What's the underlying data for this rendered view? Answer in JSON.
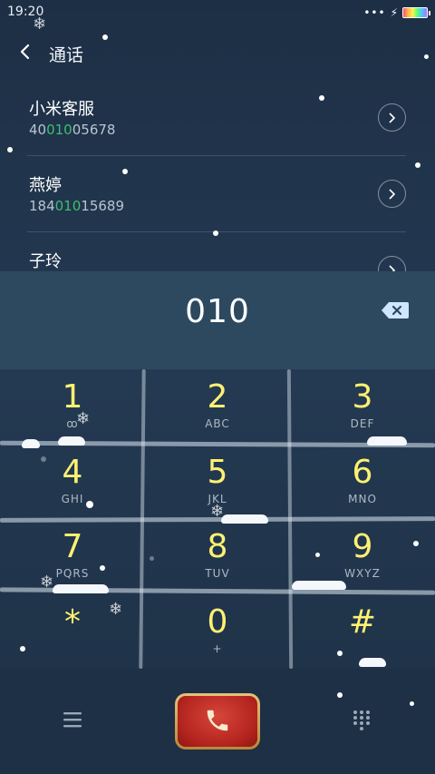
{
  "status_bar": {
    "time": "19:20",
    "signal_dots": "•••"
  },
  "header": {
    "title": "通话",
    "back_icon": "chevron-left-icon"
  },
  "contacts": [
    {
      "name": "小米客服",
      "number_pre": "40",
      "number_match": "010",
      "number_post": "05678"
    },
    {
      "name": "燕婷",
      "number_pre": "184",
      "number_match": "010",
      "number_post": "15689"
    },
    {
      "name": "子玲",
      "number_pre": "",
      "number_match": "",
      "number_post": ""
    }
  ],
  "dial_input": {
    "value": "010",
    "delete_icon": "backspace-icon"
  },
  "keypad": [
    {
      "digit": "1",
      "letters": "ꝏ"
    },
    {
      "digit": "2",
      "letters": "ABC"
    },
    {
      "digit": "3",
      "letters": "DEF"
    },
    {
      "digit": "4",
      "letters": "GHI"
    },
    {
      "digit": "5",
      "letters": "JKL"
    },
    {
      "digit": "6",
      "letters": "MNO"
    },
    {
      "digit": "7",
      "letters": "PQRS"
    },
    {
      "digit": "8",
      "letters": "TUV"
    },
    {
      "digit": "9",
      "letters": "WXYZ"
    },
    {
      "digit": "*",
      "letters": ""
    },
    {
      "digit": "0",
      "letters": "+"
    },
    {
      "digit": "#",
      "letters": ""
    }
  ],
  "bottom_bar": {
    "menu_icon": "menu-icon",
    "call_icon": "phone-icon",
    "dialpad_icon": "dialpad-icon"
  },
  "colors": {
    "match_highlight": "#3dbf73",
    "digit_color": "#fff173",
    "call_red": "#c0281f",
    "call_gold": "#d9b061"
  }
}
